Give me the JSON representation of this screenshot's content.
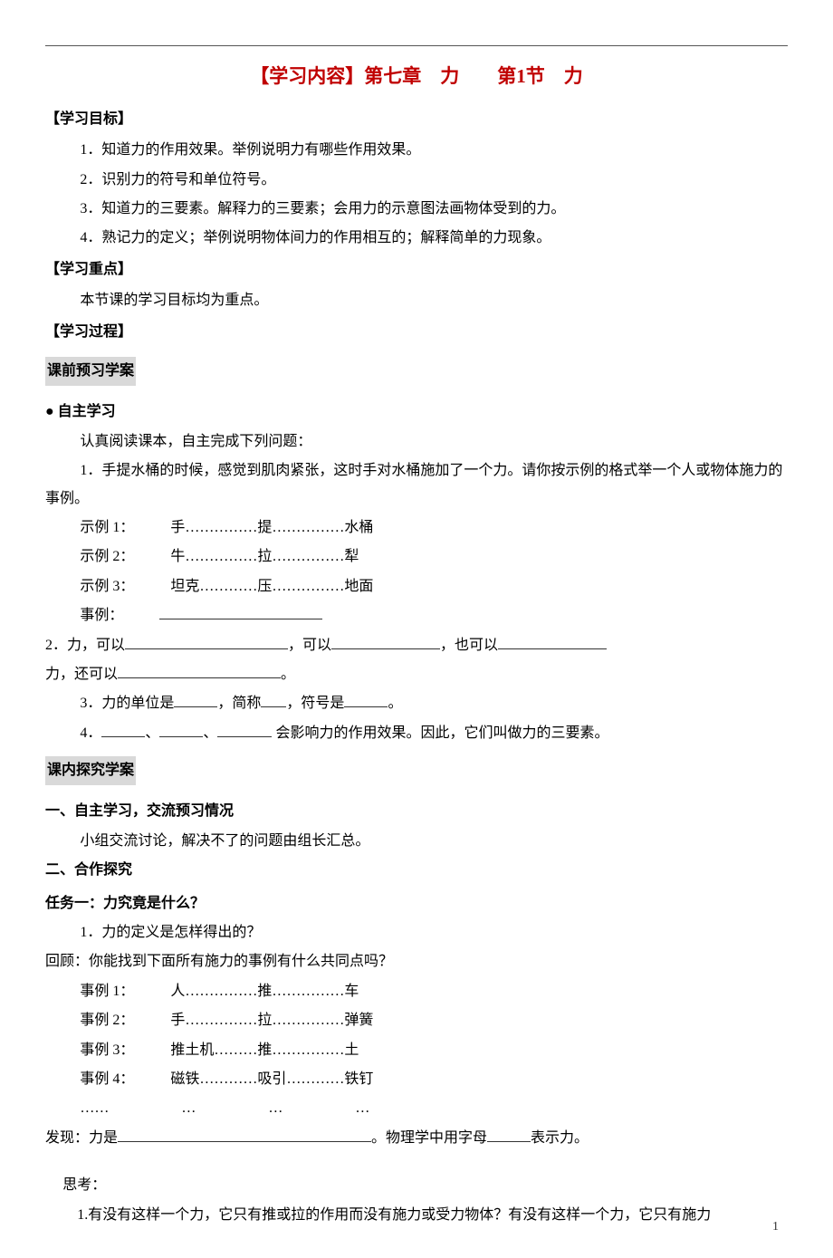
{
  "title": "【学习内容】第七章　力　　第1节　力",
  "sections": {
    "goals_header": "【学习目标】",
    "goals": [
      "1．知道力的作用效果。举例说明力有哪些作用效果。",
      "2．识别力的符号和单位符号。",
      "3．知道力的三要素。解释力的三要素；会用力的示意图法画物体受到的力。",
      "4．熟记力的定义；举例说明物体间力的作用相互的；解释简单的力现象。"
    ],
    "focus_header": "【学习重点】",
    "focus_text": "本节课的学习目标均为重点。",
    "process_header": "【学习过程】",
    "pre_class_header": "课前预习学案",
    "self_study_header": "● 自主学习",
    "self_study_intro": "认真阅读课本，自主完成下列问题：",
    "q1_intro": "1．手提水桶的时候，感觉到肌肉紧张，这时手对水桶施加了一个力。请你按示例的格式举一个人或物体施力的事例。",
    "q1_examples": [
      "示例 1：　　　手……………提……………水桶",
      "示例 2：　　　牛……………拉……………犁",
      "示例 3：　　　坦克…………压……………地面"
    ],
    "q1_case_label": "事例：",
    "q2_a": "2．力，可以",
    "q2_b": "，可以",
    "q2_c": "，也可以",
    "q2_d": "力，还可以",
    "q2_e": "。",
    "q3_a": "3．力的单位是",
    "q3_b": "，简称",
    "q3_c": "，符号是",
    "q3_d": "。",
    "q4_a": "4．",
    "q4_sep": "、",
    "q4_b": " 会影响力的作用效果。因此，它们叫做力的三要素。",
    "in_class_header": "课内探究学案",
    "ic_a_header": "一、自主学习，交流预习情况",
    "ic_a_text": "小组交流讨论，解决不了的问题由组长汇总。",
    "ic_b_header": "二、合作探究",
    "task1_header": "任务一：力究竟是什么？",
    "task1_q1": "1．力的定义是怎样得出的？",
    "task1_recall": "回顾：你能找到下面所有施力的事例有什么共同点吗？",
    "task1_examples": [
      "事例 1：　　　人……………推……………车",
      "事例 2：　　　手……………拉……………弹簧",
      "事例 3：　　　推土机………推……………土",
      "事例 4：　　　磁铁…………吸引…………铁钉",
      "……　　　　　…　　　　　…　　　　　…"
    ],
    "find_a": "发现：力是",
    "find_b": "。物理学中用字母",
    "find_c": "表示力。",
    "think_header": "思考：",
    "think_q1": "1.有没有这样一个力，它只有推或拉的作用而没有施力或受力物体？有没有这样一个力，它只有施力"
  },
  "page_number": "1"
}
